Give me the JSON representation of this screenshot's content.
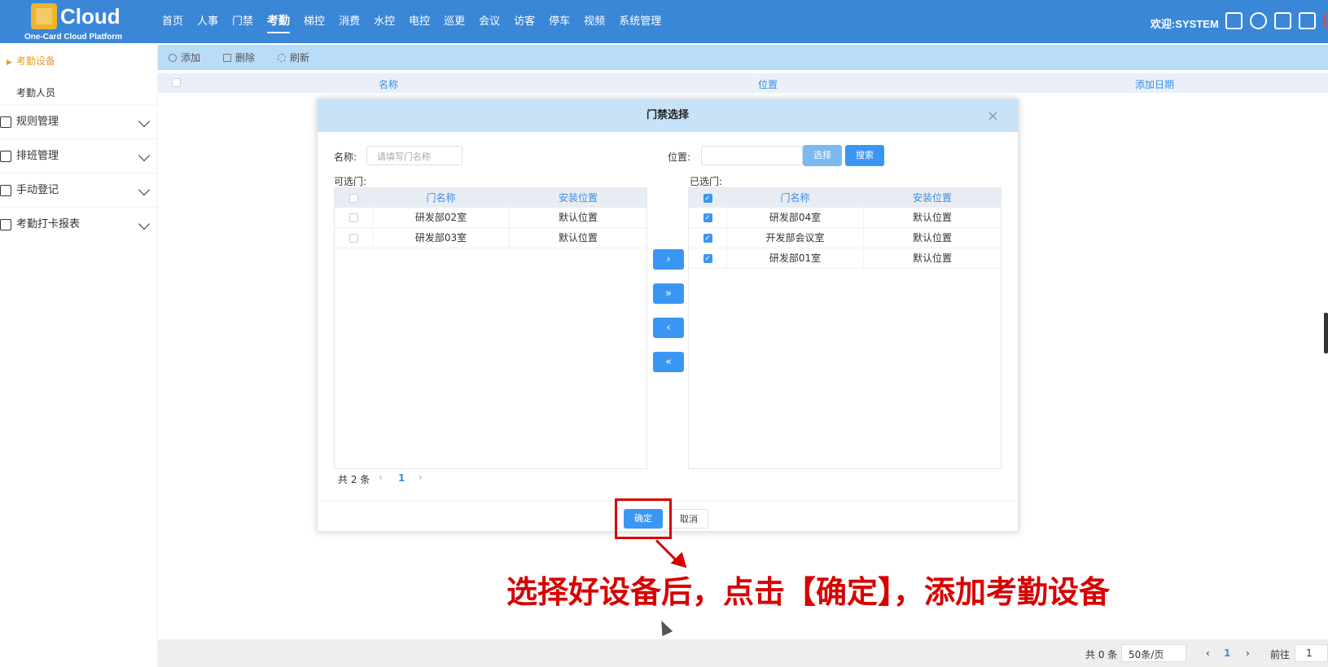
{
  "app": {
    "logo_text": "Cloud",
    "logo_subtitle": "One-Card Cloud Platform",
    "welcome": "欢迎:SYSTEM"
  },
  "nav": [
    "首页",
    "人事",
    "门禁",
    "考勤",
    "梯控",
    "消费",
    "水控",
    "电控",
    "巡更",
    "会议",
    "访客",
    "停车",
    "视频",
    "系统管理"
  ],
  "sidebar": {
    "active_item": "考勤设备",
    "sub_item": "考勤人员",
    "groups": [
      "规则管理",
      "排班管理",
      "手动登记",
      "考勤打卡报表"
    ]
  },
  "toolbar": {
    "add": "添加",
    "delete": "删除",
    "refresh": "刷新"
  },
  "table": {
    "headers": [
      "名称",
      "位置",
      "添加日期"
    ]
  },
  "pagination": {
    "total": "共 0 条",
    "page_size": "50条/页",
    "current_page": "1",
    "goto_label": "前往",
    "goto_value": "1"
  },
  "modal": {
    "title": "门禁选择",
    "name_label": "名称:",
    "name_placeholder": "请填写门名称",
    "position_label": "位置:",
    "select_button": "选择",
    "search_button": "搜索",
    "available_label": "可选门:",
    "selected_label": "已选门:",
    "column_name": "门名称",
    "column_location": "安装位置",
    "available_rows": [
      {
        "name": "研发部02室",
        "location": "默认位置"
      },
      {
        "name": "研发部03室",
        "location": "默认位置"
      }
    ],
    "selected_rows": [
      {
        "name": "研发部04室",
        "location": "默认位置"
      },
      {
        "name": "开发部会议室",
        "location": "默认位置"
      },
      {
        "name": "研发部01室",
        "location": "默认位置"
      }
    ],
    "available_total": "共 2 条",
    "available_page": "1",
    "transfer_buttons": [
      "›",
      "»",
      "‹",
      "«"
    ],
    "ok_button": "确定",
    "cancel_button": "取消"
  },
  "annotation": {
    "caption": "选择好设备后，点击【确定】，添加考勤设备"
  }
}
